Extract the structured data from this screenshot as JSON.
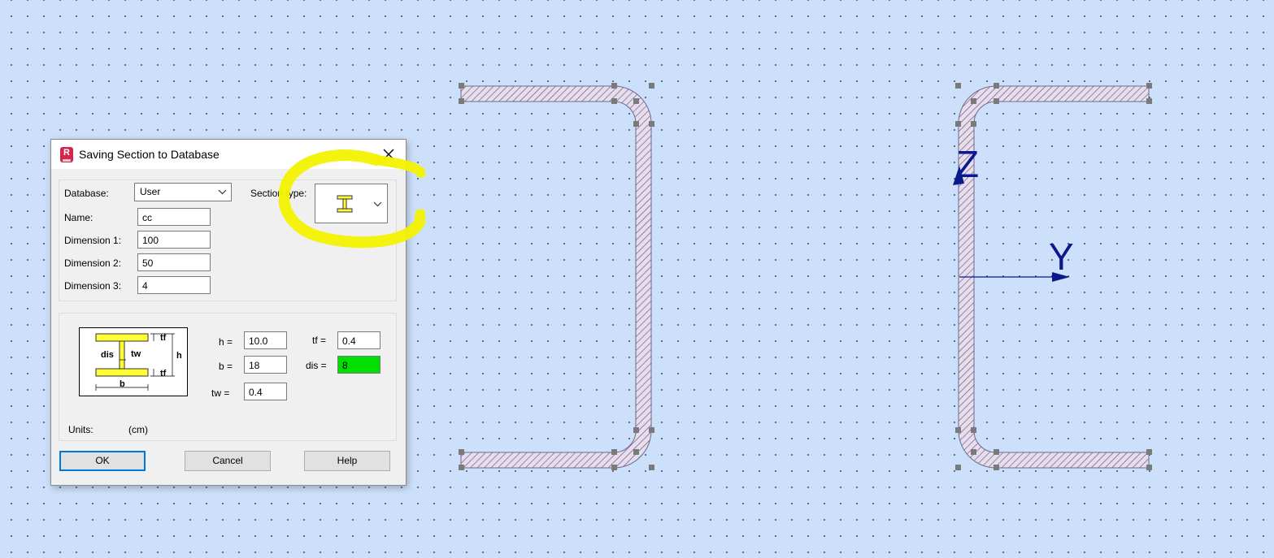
{
  "dialog": {
    "title": "Saving Section to Database",
    "app_icon_letter": "R",
    "database_label": "Database:",
    "database_value": "User",
    "section_type_label": "Section type:",
    "name_label": "Name:",
    "name_value": "cc",
    "dim1_label": "Dimension 1:",
    "dim1_value": "100",
    "dim2_label": "Dimension 2:",
    "dim2_value": "50",
    "dim3_label": "Dimension 3:",
    "dim3_value": "4",
    "params": {
      "h_label": "h =",
      "h_value": "10.0",
      "b_label": "b =",
      "b_value": "18",
      "tw_label": "tw =",
      "tw_value": "0.4",
      "tf_label": "tf =",
      "tf_value": "0.4",
      "dis_label": "dis =",
      "dis_value": "8"
    },
    "diagram_labels": {
      "tf": "tf",
      "tw": "tw",
      "h": "h",
      "dis": "dis",
      "b": "b"
    },
    "units_label": "Units:",
    "units_value": "(cm)",
    "ok_label": "OK",
    "cancel_label": "Cancel",
    "help_label": "Help"
  },
  "axes": {
    "z_label": "Z",
    "y_label": "Y"
  },
  "colors": {
    "background": "#cde0fb",
    "axis": "#0a1a8c",
    "hatch": "#a03050",
    "focused_field": "#00e000",
    "section_yellow": "#ffff33",
    "annotation_yellow": "#f2f200"
  }
}
